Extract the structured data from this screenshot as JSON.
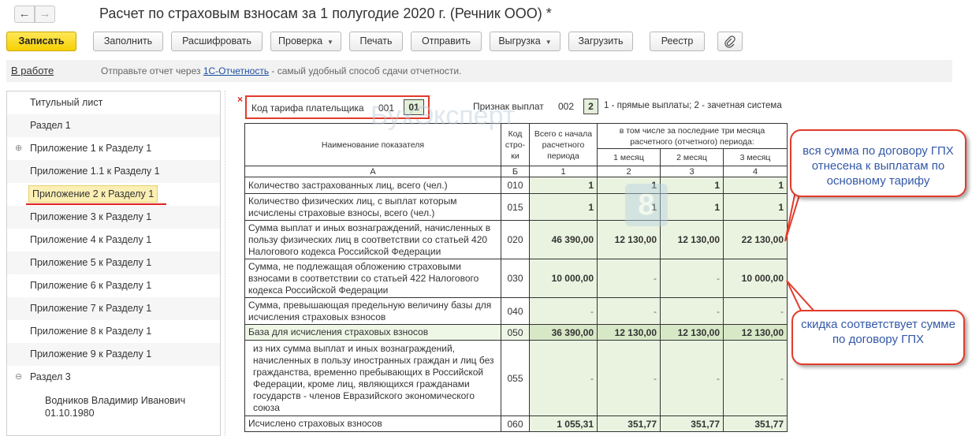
{
  "window": {
    "title": "Расчет по страховым взносам за 1 полугодие 2020 г. (Речник ООО) *",
    "back_icon": "←",
    "forward_icon": "→"
  },
  "toolbar": {
    "save": "Записать",
    "fill": "Заполнить",
    "decode": "Расшифровать",
    "check": "Проверка",
    "print": "Печать",
    "send": "Отправить",
    "export": "Выгрузка",
    "load": "Загрузить",
    "registry": "Реестр",
    "attach_icon": "paperclip-icon"
  },
  "status": {
    "state": "В работе",
    "message_before": "Отправьте отчет через ",
    "link": "1С-Отчетность",
    "message_after": " - самый удобный способ сдачи отчетности."
  },
  "sidebar": {
    "items": [
      {
        "label": "Титульный лист"
      },
      {
        "label": "Раздел 1"
      },
      {
        "label": "Приложение 1 к Разделу 1"
      },
      {
        "label": "Приложение 1.1 к Разделу 1"
      },
      {
        "label": "Приложение 2 к Разделу 1"
      },
      {
        "label": "Приложение 3 к Разделу 1"
      },
      {
        "label": "Приложение 4 к Разделу 1"
      },
      {
        "label": "Приложение 5 к Разделу 1"
      },
      {
        "label": "Приложение 6 к Разделу 1"
      },
      {
        "label": "Приложение 7 к Разделу 1"
      },
      {
        "label": "Приложение 8 к Разделу 1"
      },
      {
        "label": "Приложение 9 к Разделу 1"
      },
      {
        "label": "Раздел 3"
      }
    ],
    "expand_plus": "⊕",
    "expand_minus": "⊖",
    "person_name": "Водников Владимир Иванович",
    "person_date": "01.10.1980"
  },
  "report": {
    "error_mark": "×",
    "tariff_label": "Код тарифа плательщика",
    "tariff_line": "001",
    "tariff_value": "01",
    "payment_label": "Признак выплат",
    "payment_line": "002",
    "payment_value": "2",
    "payment_note": "1 - прямые выплаты; 2 - зачетная система",
    "headers": {
      "name": "Наименование показателя",
      "code": "Код стро- ки",
      "total": "Всего с начала расчетного периода",
      "last3": "в том числе за последние три месяца расчетного (отчетного) периода:",
      "m1": "1 месяц",
      "m2": "2 месяц",
      "m3": "3 месяц"
    },
    "index": [
      "А",
      "Б",
      "1",
      "2",
      "3",
      "4"
    ],
    "rows": [
      {
        "name": "Количество застрахованных лиц, всего (чел.)",
        "code": "010",
        "v": [
          "1",
          "1",
          "1",
          "1"
        ]
      },
      {
        "name": "Количество физических лиц, с выплат которым исчислены страховые взносы, всего (чел.)",
        "code": "015",
        "v": [
          "1",
          "1",
          "1",
          "1"
        ]
      },
      {
        "name": "Сумма выплат и иных вознаграждений, начисленных в пользу физических лиц в соответствии со статьей 420 Налогового кодекса Российской Федерации",
        "code": "020",
        "v": [
          "46 390,00",
          "12 130,00",
          "12 130,00",
          "22 130,00"
        ]
      },
      {
        "name": "Сумма, не подлежащая обложению страховыми взносами в соответствии со статьей 422 Налогового кодекса Российской Федерации",
        "code": "030",
        "v": [
          "10 000,00",
          "-",
          "-",
          "10 000,00"
        ]
      },
      {
        "name": "Сумма, превышающая предельную величину базы для исчисления страховых взносов",
        "code": "040",
        "v": [
          "-",
          "-",
          "-",
          "-"
        ]
      },
      {
        "name": "База для исчисления страховых взносов",
        "code": "050",
        "v": [
          "36 390,00",
          "12 130,00",
          "12 130,00",
          "12 130,00"
        ]
      },
      {
        "name": "из них сумма выплат и иных вознаграждений, начисленных в пользу иностранных граждан и лиц без гражданства, временно пребывающих в Российской Федерации, кроме лиц, являющихся гражданами государств - членов Евразийского экономического союза",
        "code": "055",
        "v": [
          "-",
          "-",
          "-",
          "-"
        ]
      },
      {
        "name": "Исчислено страховых взносов",
        "code": "060",
        "v": [
          "1 055,31",
          "351,77",
          "351,77",
          "351,77"
        ]
      }
    ]
  },
  "watermark": {
    "text": "БухЭксперт",
    "logo": "8"
  },
  "callouts": {
    "first": "вся сумма по договору ГПХ отнесена к выплатам по основному тарифу",
    "second": "скидка соответствует сумме по договору ГПХ"
  },
  "colors": {
    "primary_button": "#f5cf00",
    "cell_fill": "#eaf3e0",
    "callout_border": "#e23b2b",
    "callout_text": "#3358a8"
  }
}
